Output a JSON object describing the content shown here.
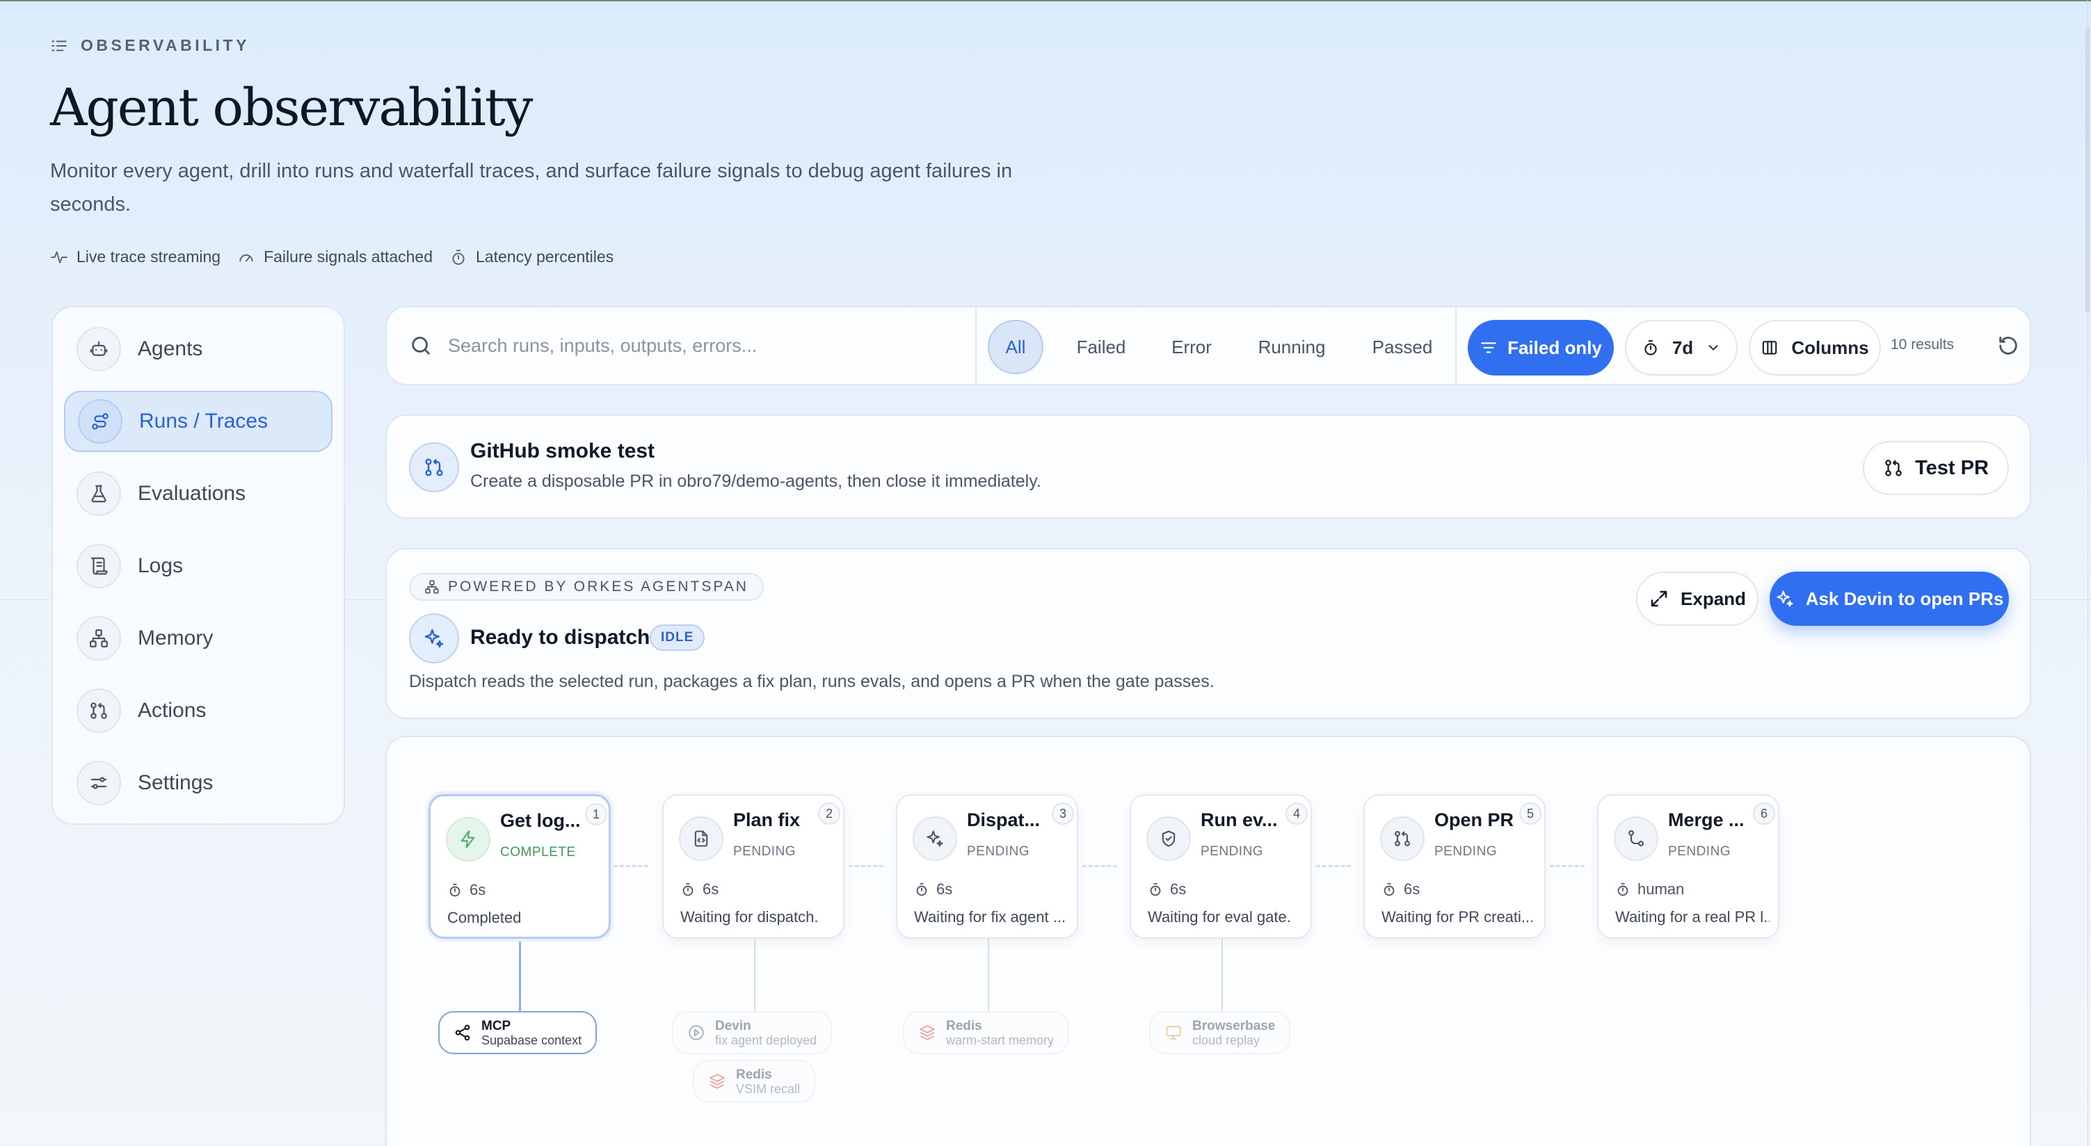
{
  "header": {
    "eyebrow": "OBSERVABILITY",
    "title": "Agent observability",
    "subtitle": "Monitor every agent, drill into runs and waterfall traces, and surface failure signals to debug agent failures in seconds.",
    "features": [
      "Live trace streaming",
      "Failure signals attached",
      "Latency percentiles"
    ]
  },
  "sidebar": {
    "items": [
      {
        "label": "Agents",
        "icon": "robot-icon"
      },
      {
        "label": "Runs / Traces",
        "icon": "route-icon",
        "active": true
      },
      {
        "label": "Evaluations",
        "icon": "flask-icon"
      },
      {
        "label": "Logs",
        "icon": "scroll-icon"
      },
      {
        "label": "Memory",
        "icon": "network-icon"
      },
      {
        "label": "Actions",
        "icon": "pull-request-icon"
      },
      {
        "label": "Settings",
        "icon": "sliders-icon"
      }
    ]
  },
  "toolbar": {
    "search_placeholder": "Search runs, inputs, outputs, errors...",
    "filters": [
      "All",
      "Failed",
      "Error",
      "Running",
      "Passed"
    ],
    "active_filter": "All",
    "failed_only_label": "Failed only",
    "range_label": "7d",
    "columns_label": "Columns",
    "results_label": "10 results"
  },
  "smoke_test": {
    "title": "GitHub smoke test",
    "description": "Create a disposable PR in obro79/demo-agents, then close it immediately.",
    "button_label": "Test PR"
  },
  "dispatch": {
    "powered_by": "POWERED BY ORKES AGENTSPAN",
    "title": "Ready to dispatch",
    "status_badge": "IDLE",
    "description": "Dispatch reads the selected run, packages a fix plan, runs evals, and opens a PR when the gate passes.",
    "expand_label": "Expand",
    "primary_label": "Ask Devin to open PRs"
  },
  "pipeline": {
    "steps": [
      {
        "num": "1",
        "title": "Get log...",
        "status": "COMPLETE",
        "duration": "6s",
        "detail": "Completed",
        "icon": "bolt-icon"
      },
      {
        "num": "2",
        "title": "Plan fix",
        "status": "PENDING",
        "duration": "6s",
        "detail": "Waiting for dispatch.",
        "icon": "code-file-icon"
      },
      {
        "num": "3",
        "title": "Dispat...",
        "status": "PENDING",
        "duration": "6s",
        "detail": "Waiting for fix agent ...",
        "icon": "sparkles-icon"
      },
      {
        "num": "4",
        "title": "Run ev...",
        "status": "PENDING",
        "duration": "6s",
        "detail": "Waiting for eval gate.",
        "icon": "shield-check-icon"
      },
      {
        "num": "5",
        "title": "Open PR",
        "status": "PENDING",
        "duration": "6s",
        "detail": "Waiting for PR creati...",
        "icon": "pull-request-icon"
      },
      {
        "num": "6",
        "title": "Merge ...",
        "status": "PENDING",
        "duration": "human",
        "detail": "Waiting for a real PR l...",
        "icon": "merge-icon"
      }
    ],
    "tools": [
      {
        "name": "MCP",
        "desc": "Supabase context",
        "icon": "share-icon"
      },
      {
        "name": "Devin",
        "desc": "fix agent deployed",
        "icon": "devin-icon"
      },
      {
        "name": "Redis",
        "desc": "VSIM recall",
        "icon": "layers-icon"
      },
      {
        "name": "Redis",
        "desc": "warm-start memory",
        "icon": "layers-icon"
      },
      {
        "name": "Browserbase",
        "desc": "cloud replay",
        "icon": "monitor-icon"
      }
    ]
  },
  "colors": {
    "accent": "#2f6ff0",
    "active_nav_text": "#2a63cf",
    "complete": "#3b9a5c"
  }
}
